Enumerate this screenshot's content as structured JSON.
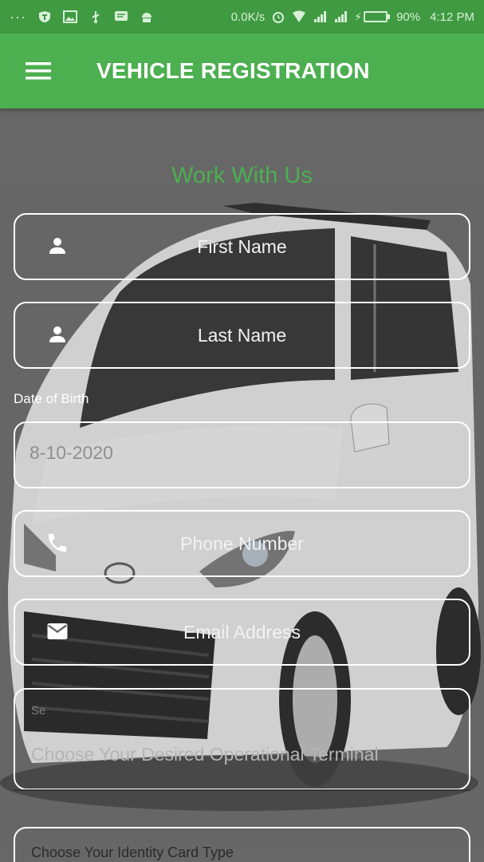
{
  "status_bar": {
    "net_speed": "0.0K/s",
    "battery_percent": "90%",
    "time": "4:12 PM",
    "battery_level": 0.9
  },
  "app_bar": {
    "title": "VEHICLE REGISTRATION"
  },
  "form": {
    "heading": "Work With Us",
    "first_name_placeholder": "First Name",
    "last_name_placeholder": "Last Name",
    "dob_label": "Date of Birth",
    "dob_value": "8-10-2020",
    "phone_placeholder": "Phone Number",
    "email_placeholder": "Email Address",
    "terminal_hint": "Se",
    "terminal_placeholder": "Choose Your Desired Operational Terminal",
    "id_card_placeholder": "Choose Your Identity Card Type"
  },
  "colors": {
    "accent": "#4caf50",
    "status_bar": "#3f9a41",
    "field_border": "#ffffff"
  },
  "icons": {
    "menu": "menu-icon",
    "person": "person-icon",
    "phone": "phone-icon",
    "email": "email-icon"
  }
}
